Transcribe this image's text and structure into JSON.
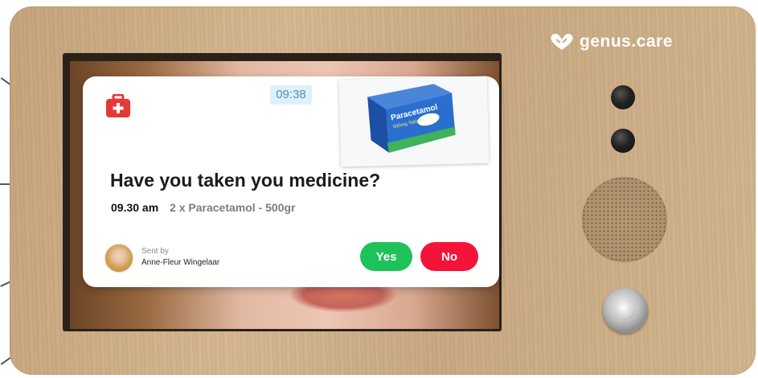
{
  "brand": {
    "name": "genus.care"
  },
  "notification": {
    "time": "09:38",
    "icon": "medical-kit-icon",
    "title": "Have you taken you medicine?",
    "dose_time": "09.30 am",
    "dose_detail": "2 x Paracetamol - 500gr",
    "product_photo": {
      "brand_text": "Paracetamol",
      "strength_text": "500mg Tablets"
    },
    "sender": {
      "label": "Sent by",
      "name": "Anne-Fleur Wingelaar"
    },
    "actions": {
      "yes_label": "Yes",
      "no_label": "No"
    }
  },
  "colors": {
    "accent_yes": "#1fc25a",
    "accent_no": "#f4143a",
    "medical_red": "#e53935",
    "time_badge_bg": "#dcf1fb",
    "device_wood": "#cfb08a"
  }
}
